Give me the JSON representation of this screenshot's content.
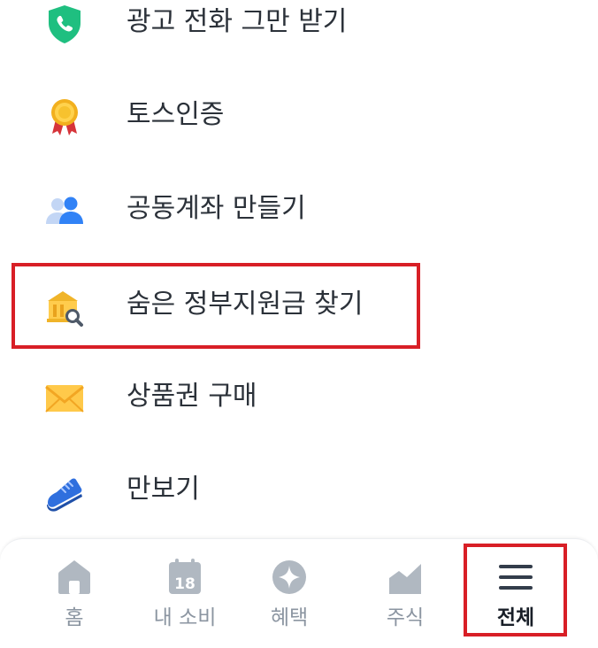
{
  "menu": {
    "items": [
      {
        "label": "광고 전화 그만 받기",
        "icon": "shield-phone-icon"
      },
      {
        "label": "토스인증",
        "icon": "medal-icon"
      },
      {
        "label": "공동계좌 만들기",
        "icon": "people-icon"
      },
      {
        "label": "숨은 정부지원금 찾기",
        "icon": "building-search-icon"
      },
      {
        "label": "상품권 구매",
        "icon": "envelope-icon"
      },
      {
        "label": "만보기",
        "icon": "sneaker-icon"
      }
    ]
  },
  "tab_bar": {
    "tabs": [
      {
        "label": "홈",
        "icon": "home-icon"
      },
      {
        "label": "내 소비",
        "icon": "calendar-icon",
        "icon_text": "18"
      },
      {
        "label": "혜택",
        "icon": "sparkle-icon"
      },
      {
        "label": "주식",
        "icon": "chart-icon"
      },
      {
        "label": "전체",
        "icon": "menu-icon",
        "active": true
      }
    ]
  },
  "colors": {
    "highlight": "#d81f26",
    "text_primary": "#2b3139",
    "tab_inactive": "#8b95a1",
    "tab_active": "#191f28"
  }
}
